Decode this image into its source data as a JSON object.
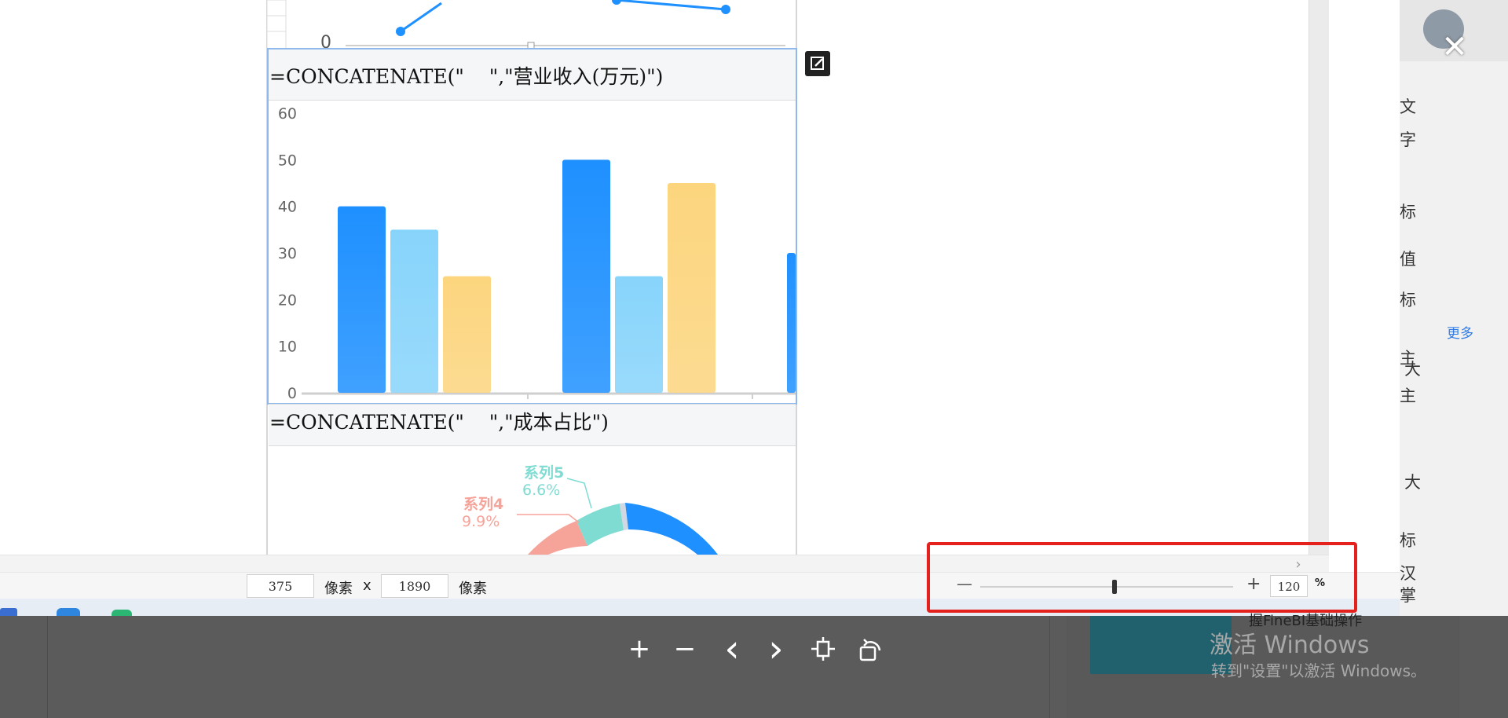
{
  "sheet": {
    "formula1": "=CONCATENATE(\"    \",\"营业收入(万元)\")",
    "formula2": "=CONCATENATE(\"    \",\"成本占比\")",
    "top_chart_zero": "0"
  },
  "chart_data": {
    "type": "bar",
    "title": "营业收入(万元)",
    "categories": [
      "",
      "",
      ""
    ],
    "series": [
      {
        "values": [
          40,
          50,
          30
        ]
      },
      {
        "values": [
          35,
          25,
          null
        ]
      },
      {
        "values": [
          25,
          45,
          null
        ]
      }
    ],
    "ylim": [
      0,
      60
    ],
    "yticks": [
      "0",
      "10",
      "20",
      "30",
      "40",
      "50",
      "60"
    ],
    "xlabel": "",
    "ylabel": "",
    "colors": [
      "#1e90ff",
      "#87d4fb",
      "#fcd57e"
    ],
    "grid": false
  },
  "pie": {
    "labels": [
      {
        "name": "系列5",
        "value": "6.6%"
      },
      {
        "name": "系列4",
        "value": "9.9%"
      }
    ],
    "colors": [
      "#7fdcd3",
      "#f6a39a",
      "#1e90ff"
    ]
  },
  "statusbar": {
    "width_value": "375",
    "width_unit": "像素",
    "x_sep": "x",
    "height_value": "1890",
    "height_unit": "像素",
    "zoom_minus": "—",
    "zoom_plus": "+",
    "zoom_value": "120",
    "zoom_unit": "%",
    "zoom_level": 0.53
  },
  "right_panel": {
    "more_link": "更多",
    "chars": [
      "文",
      "字",
      "标",
      "值",
      "标",
      "主",
      "主",
      "大",
      "大",
      "标",
      "汉",
      "掌"
    ]
  },
  "background": {
    "activate_title": "激活 Windows",
    "activate_sub": "转到\"设置\"以激活 Windows。",
    "course_text": "握FineBI基础操作"
  },
  "viewer": {
    "close": "✕",
    "zoom_in": "+",
    "zoom_out": "−",
    "prev": "‹",
    "next": "›"
  }
}
